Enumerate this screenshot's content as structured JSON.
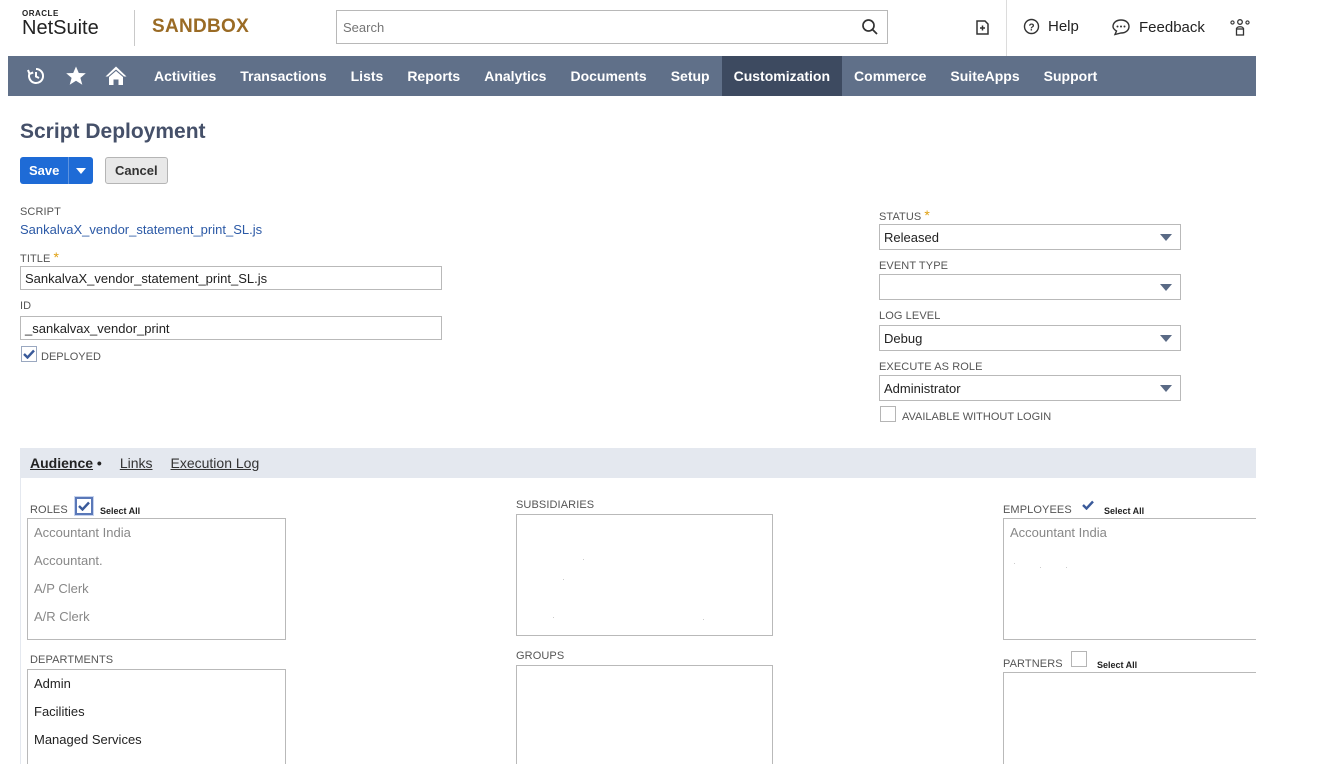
{
  "header": {
    "oracle": "ORACLE",
    "netsuite": "NetSuite",
    "environment": "SANDBOX",
    "search_placeholder": "Search",
    "help": "Help",
    "feedback": "Feedback"
  },
  "nav": {
    "items": [
      "Activities",
      "Transactions",
      "Lists",
      "Reports",
      "Analytics",
      "Documents",
      "Setup",
      "Customization",
      "Commerce",
      "SuiteApps",
      "Support"
    ],
    "active": "Customization"
  },
  "page": {
    "title": "Script Deployment",
    "save": "Save",
    "cancel": "Cancel"
  },
  "form": {
    "script_label": "SCRIPT",
    "script_value": "SankalvaX_vendor_statement_print_SL.js",
    "title_label": "TITLE",
    "title_value": "SankalvaX_vendor_statement_print_SL.js",
    "id_label": "ID",
    "id_value": "_sankalvax_vendor_print",
    "deployed_label": "DEPLOYED",
    "deployed_checked": true,
    "status_label": "STATUS",
    "status_value": "Released",
    "event_type_label": "EVENT TYPE",
    "event_type_value": "",
    "log_level_label": "LOG LEVEL",
    "log_level_value": "Debug",
    "execute_as_label": "EXECUTE AS ROLE",
    "execute_as_value": "Administrator",
    "available_label": "AVAILABLE WITHOUT LOGIN",
    "available_checked": false
  },
  "subtabs": {
    "audience": "Audience",
    "links": "Links",
    "execution_log": "Execution Log"
  },
  "audience": {
    "roles_label": "ROLES",
    "select_all": "Select All",
    "roles": [
      "Accountant India",
      "Accountant.",
      "A/P Clerk",
      "A/R Clerk"
    ],
    "subsidiaries_label": "SUBSIDIARIES",
    "employees_label": "EMPLOYEES",
    "employees": [
      "Accountant India"
    ],
    "departments_label": "DEPARTMENTS",
    "departments": [
      "Admin",
      "Facilities",
      "Managed Services"
    ],
    "groups_label": "GROUPS",
    "partners_label": "PARTNERS"
  },
  "colors": {
    "nav_bg": "#607089",
    "nav_active": "#3d4a60",
    "primary_button": "#1e6bd6",
    "sandbox_text": "#9a6b25",
    "title_text": "#455069",
    "link": "#2b59a6",
    "required": "#e0a010"
  },
  "icons": [
    "search-icon",
    "recent-records-icon",
    "star-icon",
    "home-icon",
    "help-icon",
    "feedback-icon",
    "notification-icon",
    "user-roles-icon",
    "chevron-down-icon",
    "checkmark-icon"
  ]
}
